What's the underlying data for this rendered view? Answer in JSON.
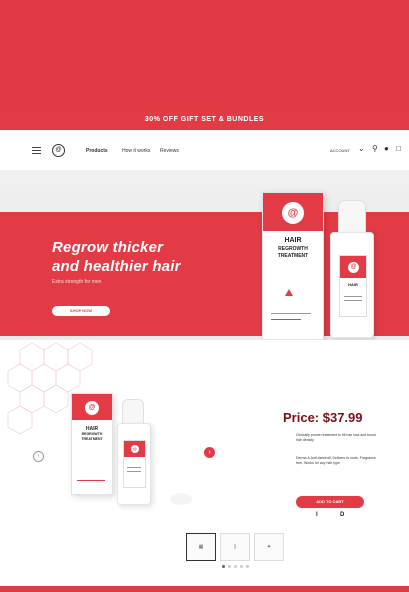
{
  "promo": {
    "text": "30% OFF GIFT SET & BUNDLES"
  },
  "nav": {
    "logo": "@",
    "links": [
      "Products",
      "How it works",
      "Reviews"
    ],
    "account": "ACCOUNT"
  },
  "hero": {
    "title_line1": "Regrow thicker",
    "title_line2": "and healthier hair",
    "subtitle": "Extra strength for men",
    "button": "SHOP NOW"
  },
  "package": {
    "brand": "HAIR",
    "name_line1": "REGROWTH",
    "name_line2": "TREATMENT",
    "emblem": "@"
  },
  "product": {
    "price": "Price: $37.99",
    "desc1": "Clinically proven treatment to fill hair loss and boost hair density",
    "desc2": "Derma & Anti-dandruff, Delivers to roots, Fragrance free, Works for any hair type",
    "add_button": "ADD TO CART",
    "qty_minus": "I",
    "qty_plus": "D"
  },
  "colors": {
    "accent": "#e23b46",
    "price": "#7a0f18"
  }
}
